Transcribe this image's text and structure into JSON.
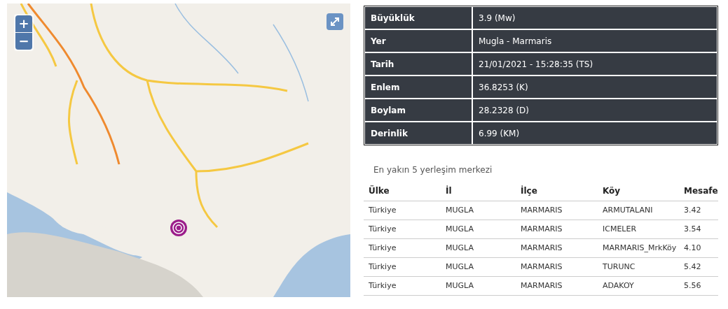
{
  "map": {
    "zoom_in": "+",
    "zoom_out": "−"
  },
  "details": [
    {
      "label": "Büyüklük",
      "value": "3.9 (Mw)"
    },
    {
      "label": "Yer",
      "value": "Mugla - Marmaris"
    },
    {
      "label": "Tarih",
      "value": "21/01/2021 - 15:28:35 (TS)"
    },
    {
      "label": "Enlem",
      "value": "36.8253 (K)"
    },
    {
      "label": "Boylam",
      "value": "28.2328 (D)"
    },
    {
      "label": "Derinlik",
      "value": "6.99 (KM)"
    }
  ],
  "nearest": {
    "caption": "En yakın 5 yerleşim merkezi",
    "columns": [
      "Ülke",
      "İl",
      "İlçe",
      "Köy",
      "Mesafe"
    ],
    "rows": [
      [
        "Türkiye",
        "MUGLA",
        "MARMARIS",
        "ARMUTALANI",
        "3.42"
      ],
      [
        "Türkiye",
        "MUGLA",
        "MARMARIS",
        "ICMELER",
        "3.54"
      ],
      [
        "Türkiye",
        "MUGLA",
        "MARMARIS",
        "MARMARIS_MrkKöy",
        "4.10"
      ],
      [
        "Türkiye",
        "MUGLA",
        "MARMARIS",
        "TURUNC",
        "5.42"
      ],
      [
        "Türkiye",
        "MUGLA",
        "MARMARIS",
        "ADAKOY",
        "5.56"
      ]
    ]
  }
}
